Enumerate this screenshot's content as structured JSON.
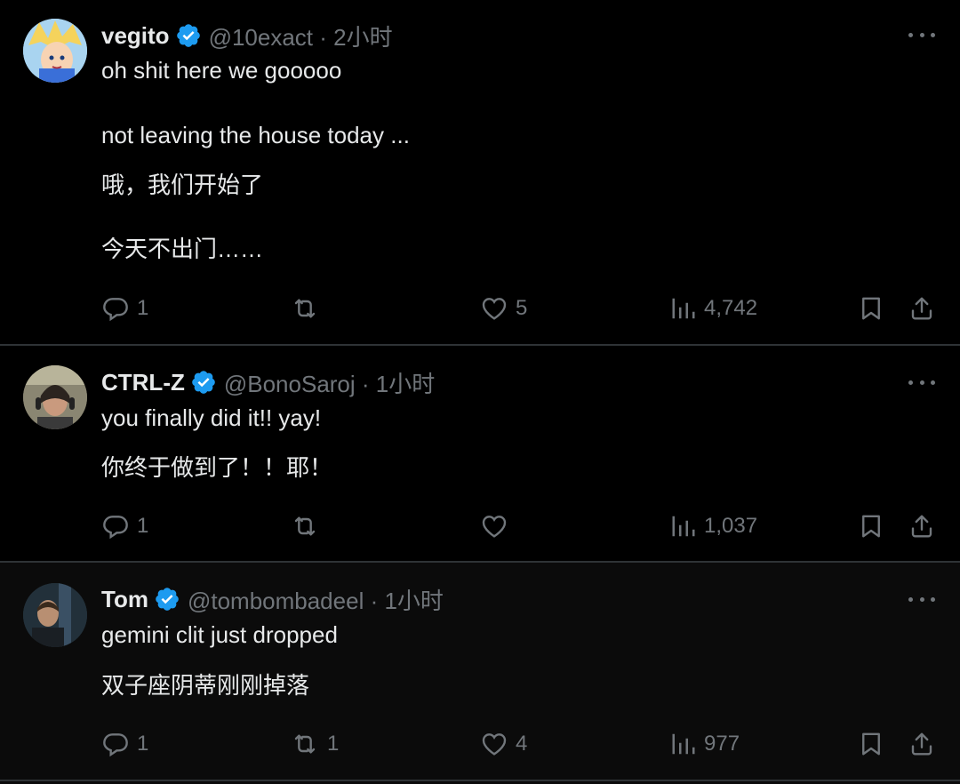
{
  "tweets": [
    {
      "name": "vegito",
      "handle": "@10exact · 2小时",
      "lines": [
        "oh shit here we gooooo",
        "not leaving the house today ...",
        "哦，我们开始了",
        "今天不出门……"
      ],
      "avatar_icon": "anime-character-avatar",
      "stats": {
        "replies": "1",
        "reposts": "",
        "likes": "5",
        "views": "4,742"
      }
    },
    {
      "name": "CTRL-Z",
      "handle": "@BonoSaroj · 1小时",
      "lines": [
        "you  finally did it!! yay!",
        "你终于做到了！！耶！"
      ],
      "avatar_icon": "person-with-headphones-avatar",
      "stats": {
        "replies": "1",
        "reposts": "",
        "likes": "",
        "views": "1,037"
      }
    },
    {
      "name": "Tom",
      "handle": "@tombombadeel · 1小时",
      "lines": [
        "gemini clit just dropped",
        "双子座阴蒂刚刚掉落"
      ],
      "avatar_icon": "man-portrait-avatar",
      "stats": {
        "replies": "1",
        "reposts": "1",
        "likes": "4",
        "views": "977"
      }
    }
  ],
  "colors": {
    "background": "#000000",
    "text": "#e7e9ea",
    "muted": "#71767b",
    "verified": "#1d9bf0",
    "divider": "#2f3336"
  }
}
